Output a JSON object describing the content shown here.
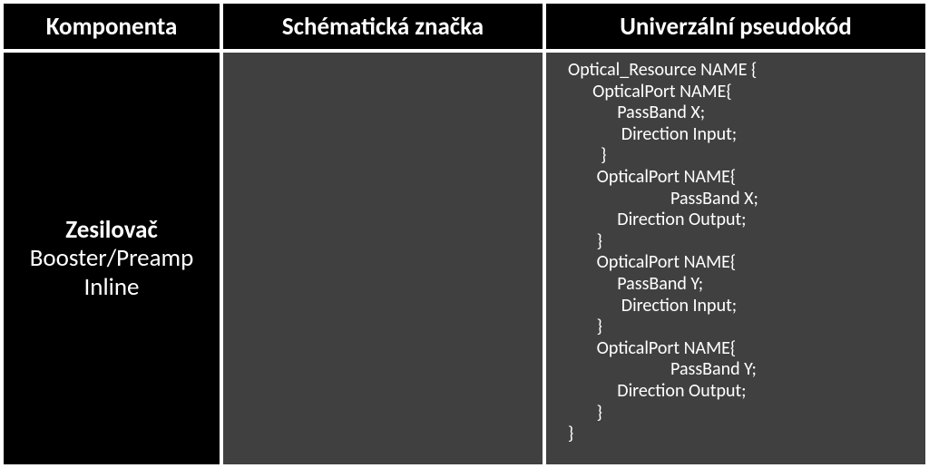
{
  "headers": {
    "col1": "Komponenta",
    "col2": "Schématická značka",
    "col3": "Univerzální pseudokód"
  },
  "row": {
    "component": {
      "title": "Zesilovač",
      "line2": "Booster/Preamp",
      "line3": "Inline"
    },
    "pseudocode": "Optical_Resource NAME {\n      OpticalPort NAME{\n            PassBand X;\n             Direction Input;\n        }\n       OpticalPort NAME{\n                         PassBand X;\n            Direction Output;\n       }\n       OpticalPort NAME{\n            PassBand Y;\n             Direction Input;\n       }\n       OpticalPort NAME{\n                         PassBand Y;\n            Direction Output;\n       }\n}"
  }
}
